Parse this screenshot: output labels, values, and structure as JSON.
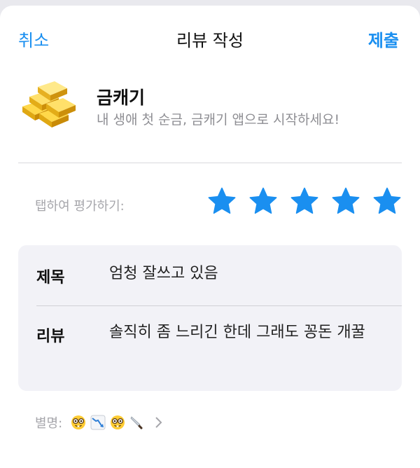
{
  "nav": {
    "cancel_label": "취소",
    "title": "리뷰 작성",
    "submit_label": "제출"
  },
  "app": {
    "name": "금캐기",
    "subtitle": "내 생애 첫 순금, 금캐기 앱으로 시작하세요!",
    "icon": "gold-bars-icon"
  },
  "rating": {
    "label": "탭하여 평가하기:",
    "value": 5,
    "max": 5,
    "star_color": "#1a8ff0"
  },
  "form": {
    "title_label": "제목",
    "title_value": "엄청 잘쓰고 있음",
    "review_label": "리뷰",
    "review_value": "솔직히 좀 느리긴 한데 그래도 꽁돈 개꿀"
  },
  "nickname": {
    "label": "별명:",
    "emojis": [
      "nerd-face-icon",
      "chart-decreasing-icon",
      "nerd-face-icon",
      "kitchen-knife-icon"
    ]
  },
  "colors": {
    "accent": "#1a8ff0",
    "card_bg": "#f2f2f7",
    "secondary_text": "#8e8e93"
  }
}
